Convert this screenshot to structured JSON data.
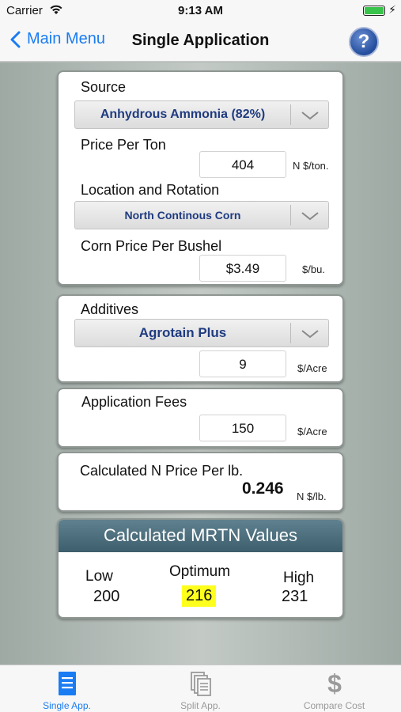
{
  "status": {
    "carrier": "Carrier",
    "time": "9:13 AM"
  },
  "nav": {
    "back_label": "Main Menu",
    "title": "Single Application",
    "help_label": "?"
  },
  "source": {
    "label": "Source",
    "selected": "Anhydrous Ammonia (82%)",
    "price_label": "Price Per Ton",
    "price_value": "404",
    "price_unit": "N $/ton.",
    "location_label": "Location and Rotation",
    "location_selected": "North Continous Corn",
    "corn_label": "Corn Price Per Bushel",
    "corn_value": "$3.49",
    "corn_unit": "$/bu."
  },
  "additives": {
    "label": "Additives",
    "selected": "Agrotain Plus",
    "value": "9",
    "unit": "$/Acre"
  },
  "fees": {
    "label": "Application Fees",
    "value": "150",
    "unit": "$/Acre"
  },
  "calc": {
    "label": "Calculated N Price Per lb.",
    "value": "0.246",
    "unit": "N $/lb."
  },
  "mrtn": {
    "title": "Calculated MRTN Values",
    "low_label": "Low",
    "low_value": "200",
    "optimum_label": "Optimum",
    "optimum_value": "216",
    "high_label": "High",
    "high_value": "231",
    "highlight_color": "#ffff1e"
  },
  "tabs": [
    {
      "label": "Single App.",
      "icon": "document-list-icon",
      "active": true
    },
    {
      "label": "Split App.",
      "icon": "stacked-pages-icon",
      "active": false
    },
    {
      "label": "Compare Cost",
      "icon": "dollar-sign-icon",
      "active": false
    }
  ],
  "colors": {
    "accent": "#1a7cf2",
    "dropdown_text": "#1f3b80",
    "header_bg": "#4e6f7d"
  }
}
